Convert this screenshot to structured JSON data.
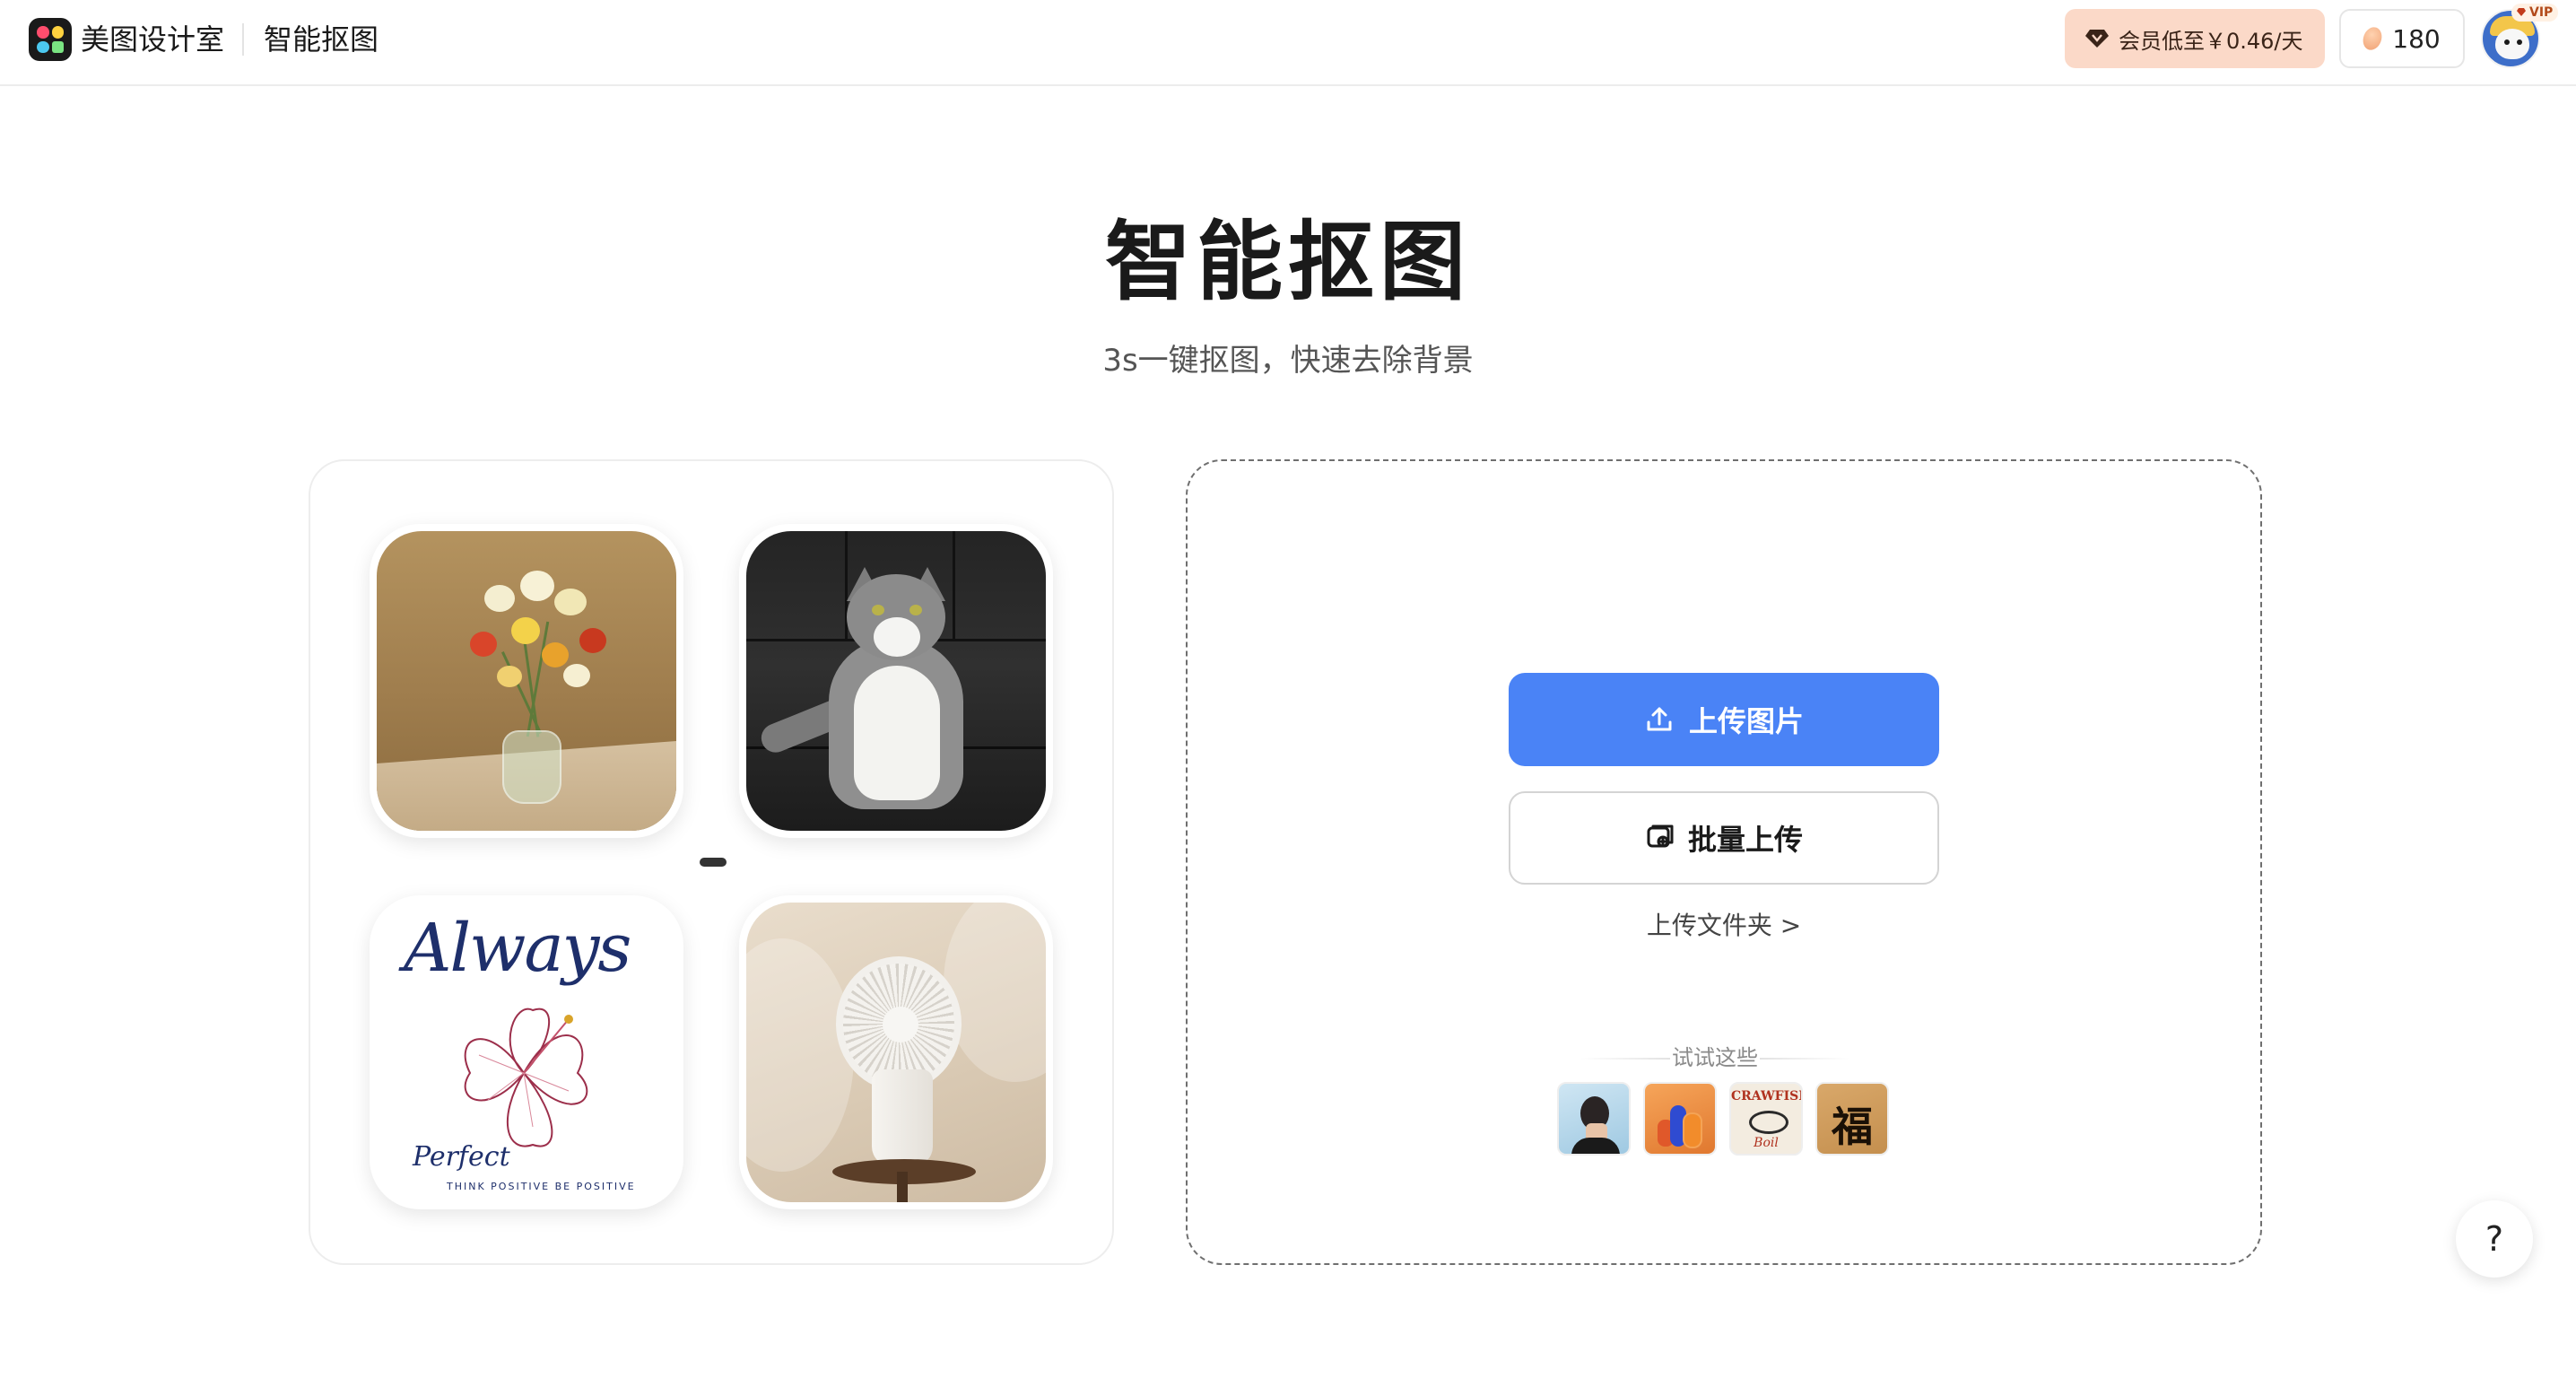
{
  "header": {
    "brand": "美图设计室",
    "tool_name": "智能抠图",
    "vip_promo": "会员低至￥0.46/天",
    "beans_count": "180",
    "vip_badge": "VIP"
  },
  "hero": {
    "title": "智能抠图",
    "subtitle": "3s一键抠图，快速去除背景"
  },
  "samples": {
    "items": [
      {
        "name": "flowers-in-vase"
      },
      {
        "name": "cat-on-sofa"
      },
      {
        "name": "always-print"
      },
      {
        "name": "desk-fan"
      }
    ],
    "print_texts": {
      "headline": "Always",
      "script": "Perfect",
      "tagline": "THINK POSITIVE BE POSITIVE"
    }
  },
  "upload": {
    "upload_button": "上传图片",
    "batch_button": "批量上传",
    "folder_link": "上传文件夹 >",
    "try_label": "试试这些",
    "try_items": [
      {
        "name": "portrait-sample"
      },
      {
        "name": "bottles-sample"
      },
      {
        "name": "crawfish-poster-sample",
        "text_top": "CRAWFISH",
        "text_bottom": "Boil"
      },
      {
        "name": "fu-character-sample",
        "text": "福"
      }
    ]
  },
  "help": {
    "label": "?"
  },
  "icons": {
    "upload": "upload-icon",
    "batch": "batch-upload-icon",
    "diamond": "diamond-icon",
    "bean": "bean-icon"
  },
  "colors": {
    "primary": "#4a83f6",
    "vip_bg": "#fbd9c8",
    "title": "#1a1a1a"
  }
}
